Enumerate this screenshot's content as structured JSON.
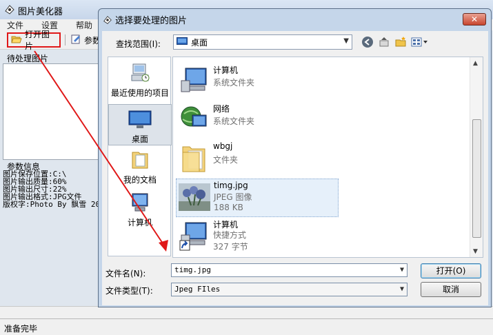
{
  "main_window": {
    "title": "图片美化器",
    "menu": [
      "文件",
      "设置",
      "帮助"
    ],
    "toolbar": {
      "open_label": "打开图片",
      "param_label": "参数"
    },
    "pending_label": "待处理图片",
    "info_label": "参数信息",
    "info_lines": [
      "图片保存位置:C:\\",
      "图片输出质量:60%",
      "图片输出尺寸:22%",
      "图片输出格式:JPG文件",
      "版权字:Photo By 飘雪 20"
    ],
    "status": "准备完毕"
  },
  "dialog": {
    "title": "选择要处理的图片",
    "close_label": "✕",
    "look_in_label": "查找范围(I):",
    "look_in_value": "桌面",
    "places": [
      {
        "label": "最近使用的项目",
        "icon": "recent-icon"
      },
      {
        "label": "桌面",
        "icon": "desktop-icon",
        "selected": true
      },
      {
        "label": "我的文档",
        "icon": "documents-icon"
      },
      {
        "label": "计算机",
        "icon": "computer-icon"
      }
    ],
    "files": [
      {
        "name": "计算机",
        "line2": "系统文件夹",
        "line3": "",
        "icon": "computer-icon"
      },
      {
        "name": "网络",
        "line2": "系统文件夹",
        "line3": "",
        "icon": "network-icon"
      },
      {
        "name": "wbgj",
        "line2": "文件夹",
        "line3": "",
        "icon": "folder-icon"
      },
      {
        "name": "timg.jpg",
        "line2": "JPEG 图像",
        "line3": "188 KB",
        "icon": "image-thumbnail",
        "selected": true
      },
      {
        "name": "计算机",
        "line2": "快捷方式",
        "line3": "327 字节",
        "icon": "shortcut-icon"
      }
    ],
    "filename_label": "文件名(N):",
    "filename_value": "timg.jpg",
    "filetype_label": "文件类型(T):",
    "filetype_value": "Jpeg FIles",
    "open_button": "打开(O)",
    "cancel_button": "取消"
  },
  "colors": {
    "annotation": "#e01818",
    "selection": "#e6f0fa",
    "dialog_frame": "#c5d6ea"
  }
}
